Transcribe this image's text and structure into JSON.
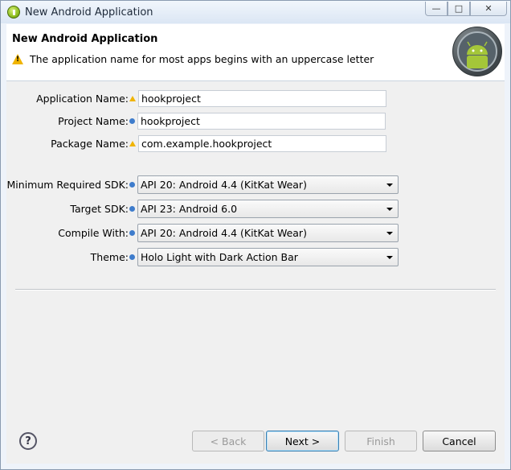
{
  "window": {
    "title": "New Android Application"
  },
  "header": {
    "title": "New Android Application",
    "message": "The application name for most apps begins with an uppercase letter"
  },
  "form": {
    "application_name": {
      "label": "Application Name:",
      "value": "hookproject"
    },
    "project_name": {
      "label": "Project Name:",
      "value": "hookproject"
    },
    "package_name": {
      "label": "Package Name:",
      "value": "com.example.hookproject"
    },
    "min_sdk": {
      "label": "Minimum Required SDK:",
      "value": "API 20: Android 4.4 (KitKat Wear)"
    },
    "target_sdk": {
      "label": "Target SDK:",
      "value": "API 23: Android 6.0"
    },
    "compile_with": {
      "label": "Compile With:",
      "value": "API 20: Android 4.4 (KitKat Wear)"
    },
    "theme": {
      "label": "Theme:",
      "value": "Holo Light with Dark Action Bar"
    }
  },
  "buttons": {
    "back": "< Back",
    "next": "Next >",
    "finish": "Finish",
    "cancel": "Cancel"
  },
  "icons": {
    "app": "android-adt-icon",
    "warning": "warning-icon",
    "info": "info-icon",
    "help": "help-icon",
    "logo": "android-logo-icon"
  },
  "colors": {
    "warning": "#f0b400",
    "info": "#3e7ccc",
    "android_green": "#a4c639"
  }
}
